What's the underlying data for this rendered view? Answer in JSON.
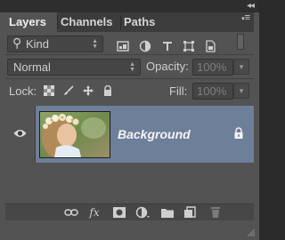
{
  "panel": {
    "collapse_glyph": "◂◂",
    "menu_glyph": "≡"
  },
  "tabs": [
    {
      "label": "Layers",
      "active": true
    },
    {
      "label": "Channels",
      "active": false
    },
    {
      "label": "Paths",
      "active": false
    }
  ],
  "filter": {
    "search_glyph": "⚲",
    "value": "Kind",
    "icons": [
      "pixel-filter-icon",
      "adjustment-filter-icon",
      "type-filter-icon",
      "shape-filter-icon",
      "smart-object-filter-icon"
    ]
  },
  "blend": {
    "mode": "Normal",
    "opacity_label": "Opacity:",
    "opacity_value": "100%"
  },
  "lock": {
    "label": "Lock:",
    "fill_label": "Fill:",
    "fill_value": "100%"
  },
  "layers": [
    {
      "name": "Background",
      "visible": true,
      "locked": true
    }
  ],
  "bottom_icons": [
    "link-icon",
    "fx-icon",
    "mask-icon",
    "adjustment-icon",
    "group-icon",
    "new-layer-icon",
    "trash-icon"
  ],
  "bottom_fx_text": "fx",
  "colors": {
    "panel_bg": "#535353",
    "selected_layer": "#6e7f99"
  }
}
